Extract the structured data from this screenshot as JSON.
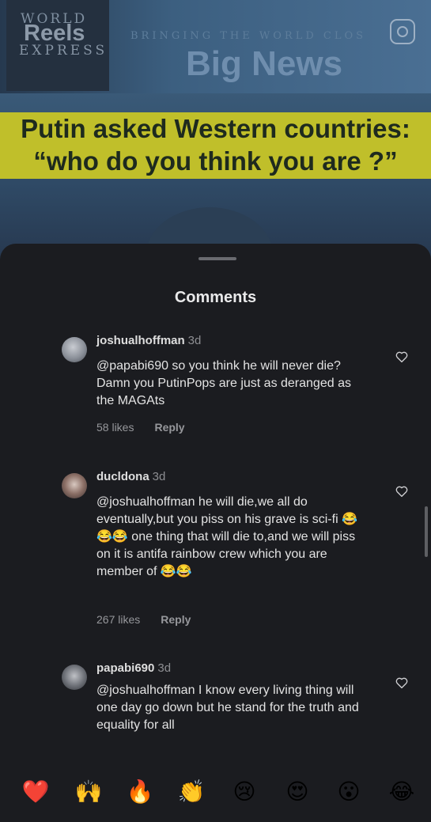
{
  "video": {
    "logo_world": "WORLD",
    "logo_reels": "Reels",
    "logo_express": "EXPRESS",
    "tagline": "BRINGING THE WORLD CLOS",
    "big_news": "Big News",
    "headline_line1": "Putin asked Western countries:",
    "headline_line2": "“who do you think you are ?”",
    "camera_icon": "camera-icon"
  },
  "sheet": {
    "title": "Comments"
  },
  "comments": [
    {
      "user": "joshualhoffman",
      "time": "3d",
      "text": "@papabi690 so you think he will never die?  Damn you PutinPops are just as deranged as the MAGAts",
      "likes": "58 likes",
      "reply": "Reply"
    },
    {
      "user": "ducldona",
      "time": "3d",
      "text": "@joshualhoffman he will die,we all do eventually,but you piss on his grave is sci-fi 😂😂😂 one thing that will die to,and we will piss on it is antifa rainbow crew which you are member of 😂😂",
      "likes": "267 likes",
      "reply": "Reply"
    },
    {
      "user": "papabi690",
      "time": "3d",
      "text": "@joshualhoffman I know every living thing will one day go down but he stand for the truth  and equality  for all"
    }
  ],
  "emoji_bar": [
    "❤️",
    "🙌",
    "🔥",
    "👏",
    "😢",
    "😍",
    "😮",
    "😂"
  ],
  "colors": {
    "sheet_background": "#1b1c20",
    "headline_background": "#c0bf2a",
    "heart_outline": "#cfcfd2"
  }
}
